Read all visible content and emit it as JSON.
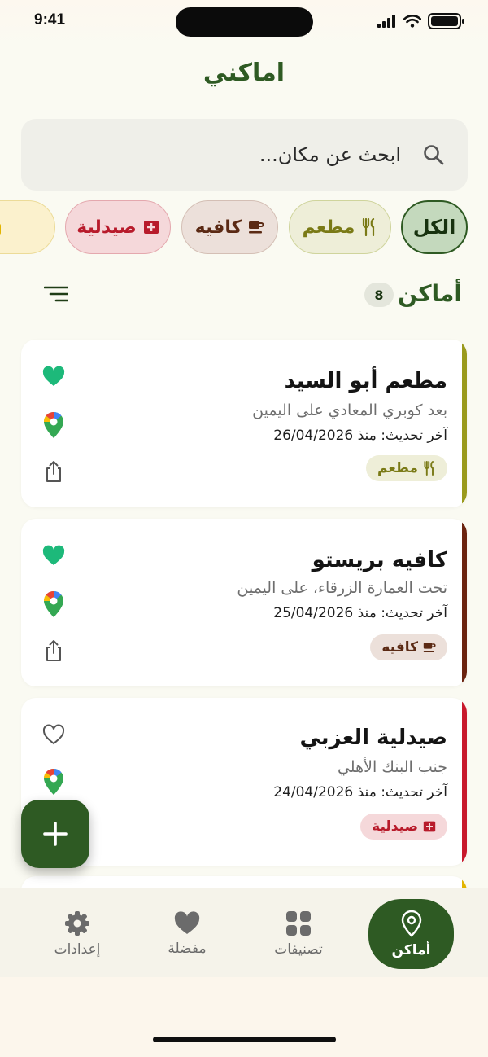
{
  "status_bar": {
    "time": "9:41"
  },
  "header": {
    "title": "اماكني"
  },
  "search": {
    "placeholder": "ابحث عن مكان..."
  },
  "categories": [
    {
      "label": "الكل",
      "selected": true,
      "color": "#2e5a23"
    },
    {
      "label": "مطعم",
      "icon": "fork-knife-icon",
      "color": "#7a7a16"
    },
    {
      "label": "كافيه",
      "icon": "coffee-cup-icon",
      "color": "#5b2a14"
    },
    {
      "label": "صيدلية",
      "icon": "medical-cross-icon",
      "color": "#b81b2b"
    },
    {
      "label": "سو",
      "icon": "shopping-bag-icon",
      "color": "#d6a500"
    }
  ],
  "section": {
    "title": "أماكن",
    "count": "8"
  },
  "places": [
    {
      "name": "مطعم أبو السيد",
      "address": "بعد كوبري المعادي على اليمين",
      "updated": "آخر تحديث: منذ 26/04/2026",
      "tag": "مطعم",
      "favorite": true,
      "accent": "#9a9a1d"
    },
    {
      "name": "كافيه بريستو",
      "address": "تحت العمارة الزرقاء، على اليمين",
      "updated": "آخر تحديث: منذ 25/04/2026",
      "tag": "كافيه",
      "favorite": true,
      "accent": "#6b2410"
    },
    {
      "name": "صيدلية العزبي",
      "address": "جنب البنك الأهلي",
      "updated": "آخر تحديث: منذ 24/04/2026",
      "tag": "صيدلية",
      "favorite": false,
      "accent": "#c8192c"
    }
  ],
  "nav": [
    {
      "label": "أماكن",
      "icon": "map-pin-icon",
      "active": true
    },
    {
      "label": "تصنيفات",
      "icon": "grid-icon"
    },
    {
      "label": "مفضلة",
      "icon": "heart-icon"
    },
    {
      "label": "إعدادات",
      "icon": "gear-icon"
    }
  ],
  "colors": {
    "primary": "#2e5a23",
    "favorite": "#1db97a",
    "background": "#fafaf2"
  }
}
